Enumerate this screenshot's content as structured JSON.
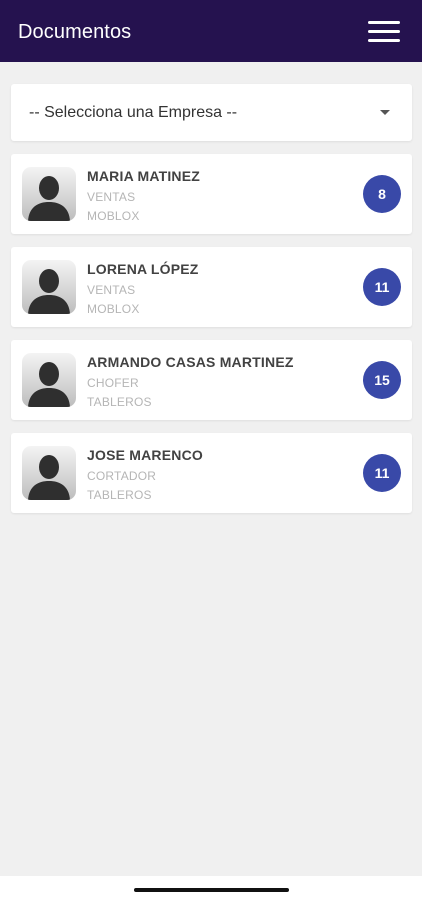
{
  "header": {
    "title": "Documentos",
    "menu_icon": "hamburger-menu-icon",
    "background_color": "#25124f"
  },
  "company_select": {
    "selected": "-- Selecciona una Empresa --",
    "caret_icon": "caret-down-icon"
  },
  "employees": [
    {
      "name": "MARIA MATINEZ",
      "role": "VENTAS",
      "company": "MOBLOX",
      "count": "8"
    },
    {
      "name": "LORENA LÓPEZ",
      "role": "VENTAS",
      "company": "MOBLOX",
      "count": "11"
    },
    {
      "name": "ARMANDO CASAS MARTINEZ",
      "role": "CHOFER",
      "company": "TABLEROS",
      "count": "15"
    },
    {
      "name": "JOSE MARENCO",
      "role": "CORTADOR",
      "company": "TABLEROS",
      "count": "11"
    }
  ],
  "colors": {
    "badge": "#3949a8",
    "page_background": "#f0f0f0"
  }
}
